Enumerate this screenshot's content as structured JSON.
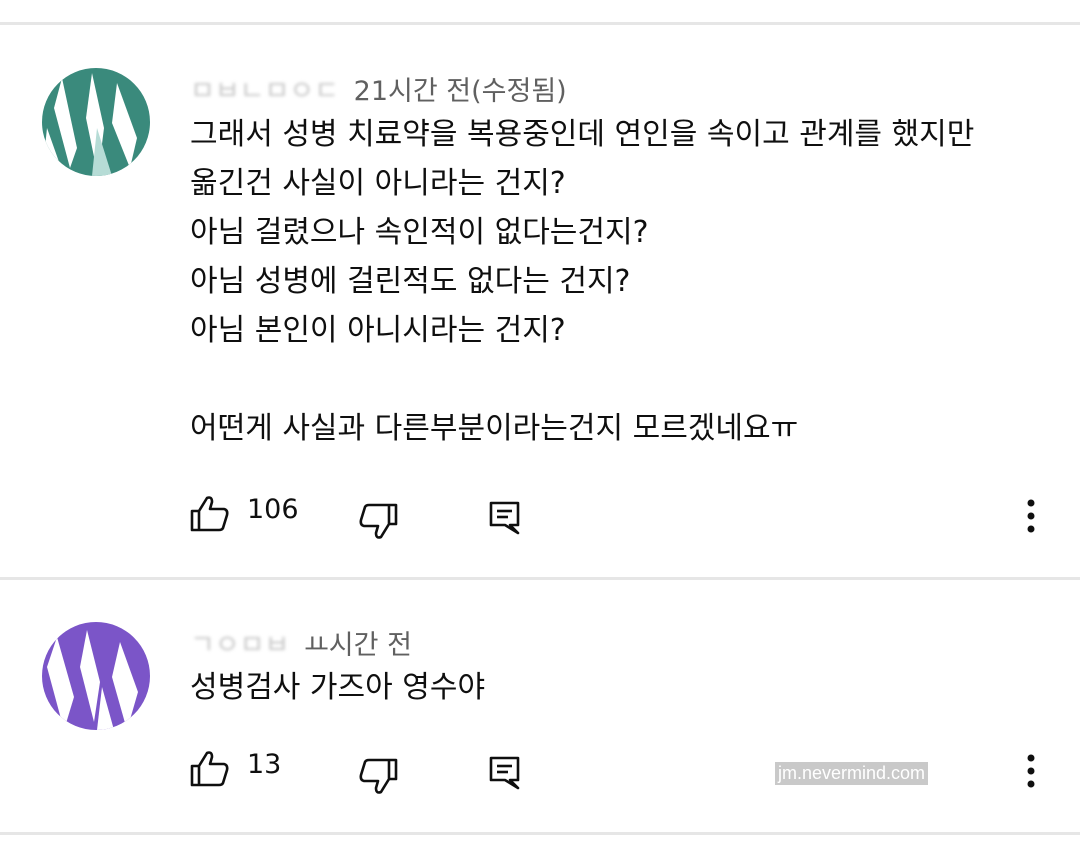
{
  "comments": [
    {
      "author": "ㅁㅂㄴㅁㅇㄷ",
      "time": "21시간 전(수정됨)",
      "text": "그래서 성병 치료약을 복용중인데 연인을 속이고 관계를 했지만\n옮긴건 사실이 아니라는 건지?\n아님 걸렸으나 속인적이 없다는건지?\n아님 성병에 걸린적도 없다는 건지?\n아님 본인이 아니시라는 건지?\n\n어떤게 사실과 다른부분이라는건지 모르겠네요ㅠ",
      "likes": "106",
      "avatar_color": "#3a8a7c"
    },
    {
      "author": "ㄱㅇㅁㅂ",
      "time": "ㅛ시간 전",
      "text": "성병검사 가즈아 영수야",
      "likes": "13",
      "avatar_color": "#7b55c8"
    }
  ],
  "watermark": "jm.nevermind.com",
  "icons": {
    "like": "thumbs-up-icon",
    "dislike": "thumbs-down-icon",
    "reply": "reply-icon",
    "more": "more-vertical-icon"
  }
}
